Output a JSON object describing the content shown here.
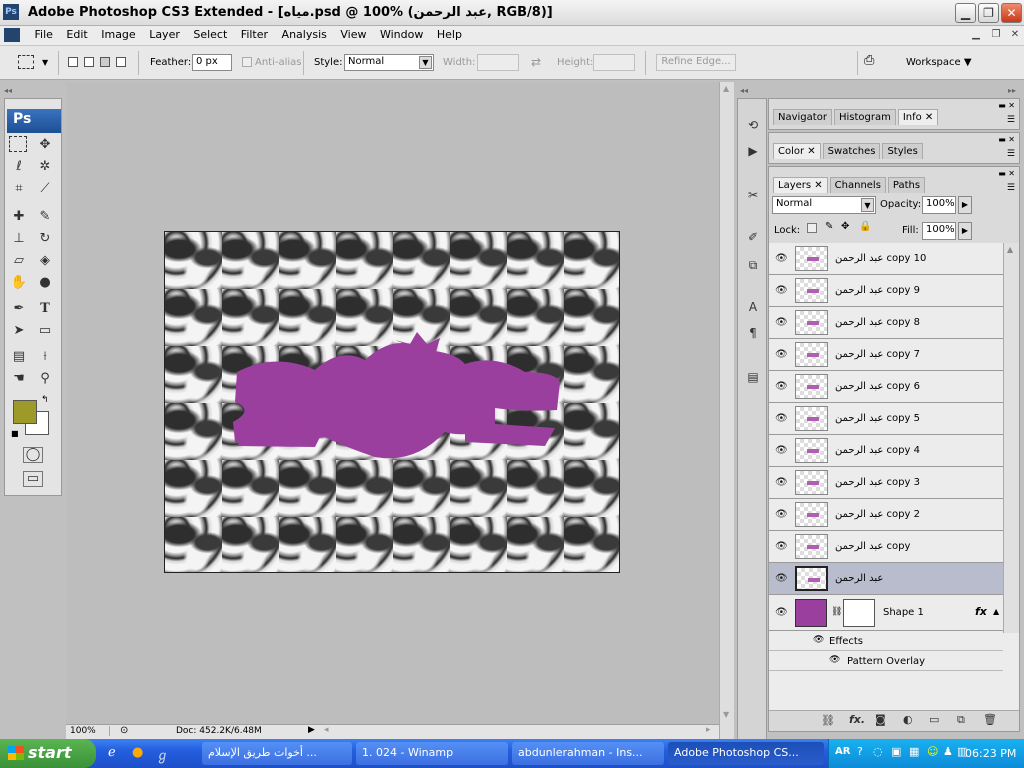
{
  "window": {
    "title": "Adobe Photoshop CS3 Extended - [مياه.psd @ 100% (عبد الرحمن, RGB/8)]"
  },
  "menu": [
    "File",
    "Edit",
    "Image",
    "Layer",
    "Select",
    "Filter",
    "Analysis",
    "View",
    "Window",
    "Help"
  ],
  "options": {
    "feather_label": "Feather:",
    "feather_value": "0 px",
    "antialias": "Anti-alias",
    "style_label": "Style:",
    "style_value": "Normal",
    "width_label": "Width:",
    "height_label": "Height:",
    "refine": "Refine Edge...",
    "workspace": "Workspace"
  },
  "panels": {
    "top_tabs": [
      "Navigator",
      "Histogram",
      "Info"
    ],
    "mid_tabs": [
      "Color",
      "Swatches",
      "Styles"
    ],
    "layer_tabs": [
      "Layers",
      "Channels",
      "Paths"
    ],
    "blend": "Normal",
    "opacity_label": "Opacity:",
    "opacity_value": "100%",
    "lock_label": "Lock:",
    "fill_label": "Fill:",
    "fill_value": "100%"
  },
  "layers": [
    "عبد الرحمن copy 10",
    "عبد الرحمن copy 9",
    "عبد الرحمن copy 8",
    "عبد الرحمن copy 7",
    "عبد الرحمن copy 6",
    "عبد الرحمن copy 5",
    "عبد الرحمن copy 4",
    "عبد الرحمن copy 3",
    "عبد الرحمن copy 2",
    "عبد الرحمن copy",
    "عبد الرحمن"
  ],
  "shape_layer": {
    "name": "Shape 1",
    "effects": "Effects",
    "pattern": "Pattern Overlay",
    "color": "#9b3f9e"
  },
  "status": {
    "zoom": "100%",
    "doc": "Doc: 452.2K/6.48M"
  },
  "taskbar": {
    "start": "start",
    "tasks": [
      "أخوات طريق الإسلام ...",
      "1. 024 - Winamp",
      "abdunlerahman - Ins...",
      "Adobe Photoshop CS..."
    ],
    "lang": "AR",
    "time": "06:23 PM"
  },
  "colors": {
    "foreground": "#9e9a2a",
    "accent": "#9b3f9e"
  }
}
